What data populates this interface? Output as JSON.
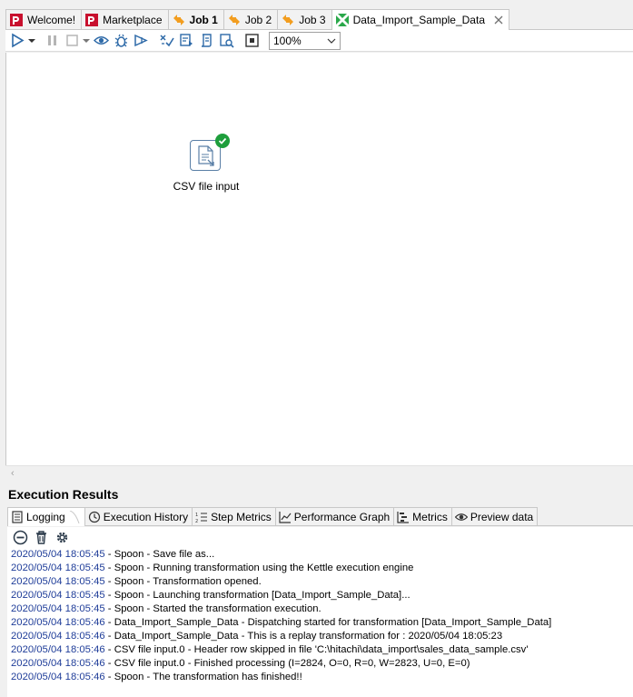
{
  "tabs": [
    {
      "label": "Welcome!",
      "icon": "pentaho-logo-icon",
      "bold": false
    },
    {
      "label": "Marketplace",
      "icon": "pentaho-logo-icon",
      "bold": false
    },
    {
      "label": "Job 1",
      "icon": "job-icon",
      "bold": true
    },
    {
      "label": "Job 2",
      "icon": "job-icon",
      "bold": false
    },
    {
      "label": "Job 3",
      "icon": "job-icon",
      "bold": false
    },
    {
      "label": "Data_Import_Sample_Data",
      "icon": "transformation-icon",
      "bold": false,
      "active": true
    }
  ],
  "toolbar": {
    "zoom_value": "100%"
  },
  "canvas": {
    "step_label": "CSV file input"
  },
  "results": {
    "title": "Execution Results",
    "tabs": [
      {
        "label": "Logging",
        "icon": "logging-icon"
      },
      {
        "label": "Execution History",
        "icon": "history-icon"
      },
      {
        "label": "Step Metrics",
        "icon": "step-metrics-icon"
      },
      {
        "label": "Performance Graph",
        "icon": "performance-graph-icon"
      },
      {
        "label": "Metrics",
        "icon": "metrics-icon"
      },
      {
        "label": "Preview data",
        "icon": "preview-icon"
      }
    ],
    "log_lines": [
      {
        "ts": "2020/05/04 18:05:45",
        "msg": " - Spoon - Save file as..."
      },
      {
        "ts": "2020/05/04 18:05:45",
        "msg": " - Spoon - Running transformation using the Kettle execution engine"
      },
      {
        "ts": "2020/05/04 18:05:45",
        "msg": " - Spoon - Transformation opened."
      },
      {
        "ts": "2020/05/04 18:05:45",
        "msg": " - Spoon - Launching transformation [Data_Import_Sample_Data]..."
      },
      {
        "ts": "2020/05/04 18:05:45",
        "msg": " - Spoon - Started the transformation execution."
      },
      {
        "ts": "2020/05/04 18:05:46",
        "msg": " - Data_Import_Sample_Data - Dispatching started for transformation [Data_Import_Sample_Data]"
      },
      {
        "ts": "2020/05/04 18:05:46",
        "msg": " - Data_Import_Sample_Data - This is a replay transformation for : 2020/05/04 18:05:23"
      },
      {
        "ts": "2020/05/04 18:05:46",
        "msg": " - CSV file input.0 - Header row skipped in file 'C:\\hitachi\\data_import\\sales_data_sample.csv'"
      },
      {
        "ts": "2020/05/04 18:05:46",
        "msg": " - CSV file input.0 - Finished processing (I=2824, O=0, R=0, W=2823, U=0, E=0)"
      },
      {
        "ts": "2020/05/04 18:05:46",
        "msg": " - Spoon - The transformation has finished!!"
      }
    ]
  },
  "colors": {
    "timestamp": "#1f3d99",
    "toolbar_icon": "#2e6aa8",
    "success": "#1e9e3c"
  }
}
